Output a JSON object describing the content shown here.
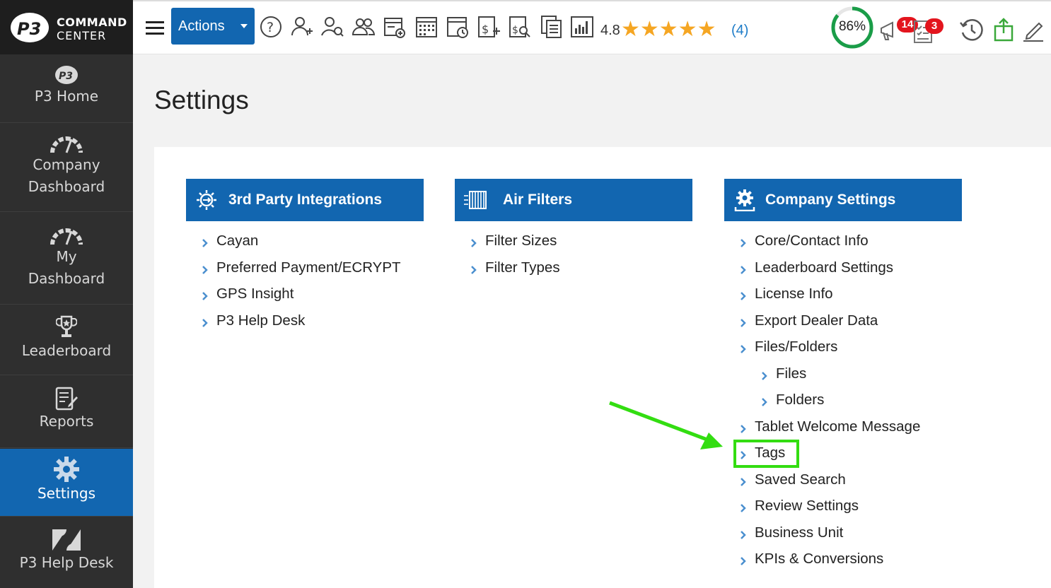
{
  "app": {
    "logo_line1": "COMMAND",
    "logo_line2": "CENTER"
  },
  "sidebar": {
    "items": [
      {
        "label": "P3 Home",
        "icon": "p3-logo-icon",
        "active": false
      },
      {
        "label": "Company\nDashboard",
        "icon": "speedometer-icon",
        "active": false
      },
      {
        "label": "My\nDashboard",
        "icon": "speedometer-icon",
        "active": false
      },
      {
        "label": "Leaderboard",
        "icon": "trophy-icon",
        "active": false
      },
      {
        "label": "Reports",
        "icon": "report-icon",
        "active": false
      },
      {
        "label": "Settings",
        "icon": "gear-icon",
        "active": true
      },
      {
        "label": "P3 Help Desk",
        "icon": "zendesk-icon",
        "active": false
      }
    ]
  },
  "topbar": {
    "actions_label": "Actions",
    "icons": [
      "help-icon",
      "add-user-icon",
      "search-user-icon",
      "users-icon",
      "add-calendar-icon",
      "calendar-icon",
      "calendar-clock-icon",
      "add-invoice-icon",
      "search-invoice-icon",
      "documents-icon",
      "bar-chart-icon"
    ],
    "rating": "4.8",
    "stars": "★★★★★",
    "rating_count": "(4)",
    "progress_percent": 86,
    "progress_label": "86%",
    "notifications_badge": "14",
    "tasks_badge": "3",
    "right_icons": [
      "megaphone-icon",
      "checklist-icon",
      "history-icon",
      "upload-icon",
      "edit-icon"
    ]
  },
  "colors": {
    "brand_blue": "#1266b0",
    "sidebar_bg": "#2f2f2f",
    "progress_green": "#1a9d48",
    "badge_red": "#e3151e",
    "star_gold": "#f5a623",
    "highlight_green": "#33dd11"
  },
  "page": {
    "title": "Settings"
  },
  "cards": [
    {
      "title": "3rd Party Integrations",
      "icon": "integration-gear-icon",
      "links": [
        {
          "label": "Cayan",
          "level": 0
        },
        {
          "label": "Preferred Payment/ECRYPT",
          "level": 0
        },
        {
          "label": "GPS Insight",
          "level": 0
        },
        {
          "label": "P3 Help Desk",
          "level": 0
        }
      ]
    },
    {
      "title": "Air Filters",
      "icon": "air-filter-icon",
      "links": [
        {
          "label": "Filter Sizes",
          "level": 0
        },
        {
          "label": "Filter Types",
          "level": 0
        }
      ]
    },
    {
      "title": "Company Settings",
      "icon": "company-gear-icon",
      "links": [
        {
          "label": "Core/Contact Info",
          "level": 0
        },
        {
          "label": "Leaderboard Settings",
          "level": 0
        },
        {
          "label": "License Info",
          "level": 0
        },
        {
          "label": "Export Dealer Data",
          "level": 0
        },
        {
          "label": "Files/Folders",
          "level": 0
        },
        {
          "label": "Files",
          "level": 1
        },
        {
          "label": "Folders",
          "level": 1
        },
        {
          "label": "Tablet Welcome Message",
          "level": 0
        },
        {
          "label": "Tags",
          "level": 0
        },
        {
          "label": "Saved Search",
          "level": 0
        },
        {
          "label": "Review Settings",
          "level": 0
        },
        {
          "label": "Business Unit",
          "level": 0
        },
        {
          "label": "KPIs & Conversions",
          "level": 0
        }
      ]
    }
  ]
}
